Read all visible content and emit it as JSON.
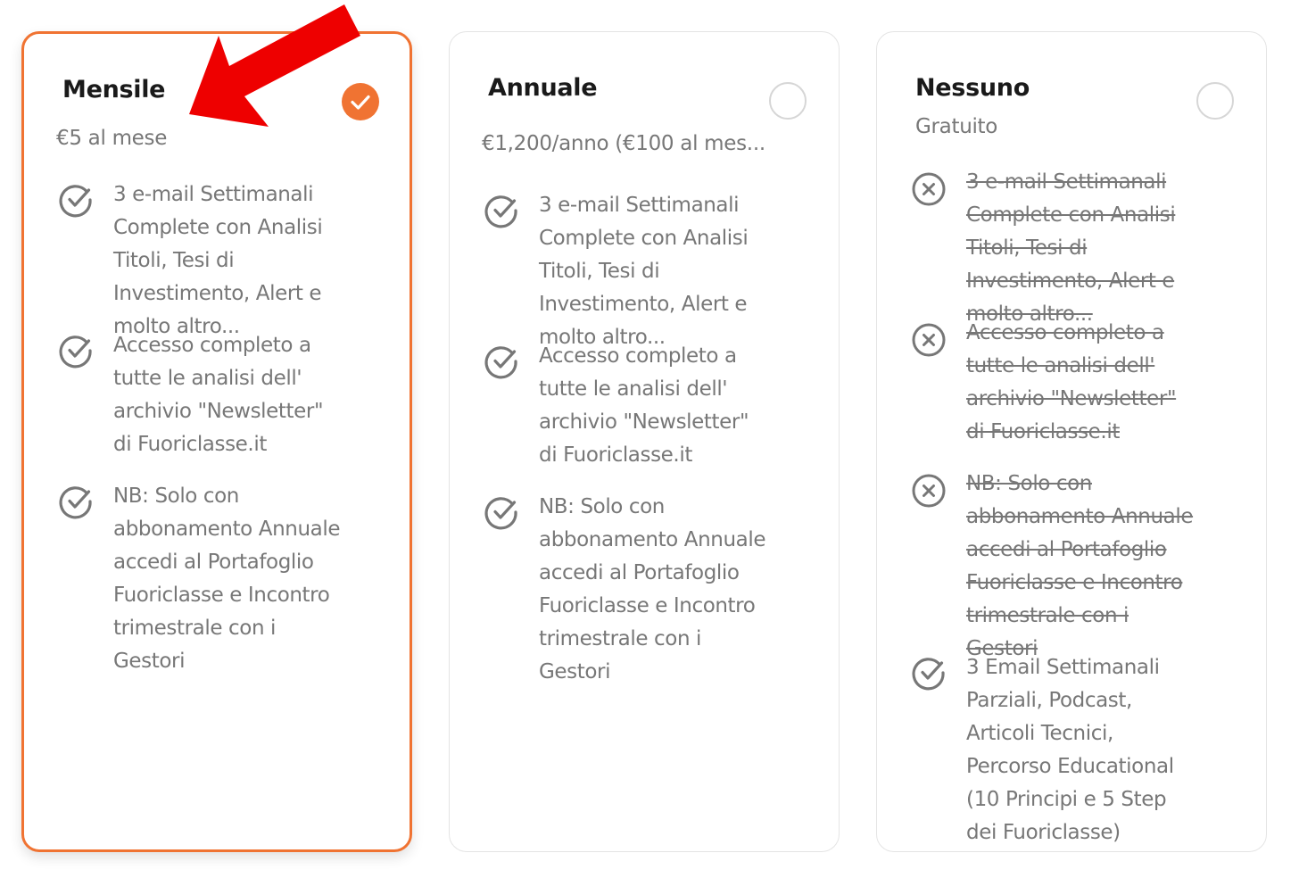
{
  "plans": [
    {
      "title": "Mensile",
      "price": "€5 al mese",
      "selected": true,
      "features": [
        {
          "text": "3 e-mail Settimanali Complete con Analisi Titoli, Tesi di Investimento, Alert e molto altro...",
          "included": true
        },
        {
          "text": "Accesso completo a tutte le analisi dell' archivio \"Newsletter\" di Fuoriclasse.it",
          "included": true
        },
        {
          "text": "NB: Solo con abbonamento Annuale accedi al Portafoglio Fuoriclasse e Incontro trimestrale con i Gestori",
          "included": true
        }
      ]
    },
    {
      "title": "Annuale",
      "price": "€1,200/anno (€100 al mes...",
      "selected": false,
      "features": [
        {
          "text": "3 e-mail Settimanali Complete con Analisi Titoli, Tesi di Investimento, Alert e molto altro...",
          "included": true
        },
        {
          "text": "Accesso completo a tutte le analisi dell' archivio \"Newsletter\" di Fuoriclasse.it",
          "included": true
        },
        {
          "text": "NB: Solo con abbonamento Annuale accedi al Portafoglio Fuoriclasse e Incontro trimestrale con i Gestori",
          "included": true
        }
      ]
    },
    {
      "title": "Nessuno",
      "price": "Gratuito",
      "selected": false,
      "features": [
        {
          "text": "3 e-mail Settimanali Complete con Analisi Titoli, Tesi di Investimento, Alert e molto altro...",
          "included": false
        },
        {
          "text": "Accesso completo a tutte le analisi dell' archivio \"Newsletter\" di Fuoriclasse.it",
          "included": false
        },
        {
          "text": "NB: Solo con abbonamento Annuale accedi al Portafoglio Fuoriclasse e Incontro trimestrale con i Gestori",
          "included": false
        },
        {
          "text": "3 Email Settimanali Parziali, Podcast, Articoli Tecnici, Percorso Educational (10 Principi e 5 Step dei Fuoriclasse)",
          "included": true
        }
      ]
    }
  ],
  "icons": {
    "included": "check-circle-icon",
    "excluded": "x-circle-icon",
    "selected": "checkmark-icon",
    "annotation": "red-arrow-icon"
  },
  "colors": {
    "accent": "#f07332",
    "text_muted": "#777777",
    "title": "#1a1a1a",
    "border": "#e4e4e4",
    "annotation_arrow": "#ee0000"
  }
}
